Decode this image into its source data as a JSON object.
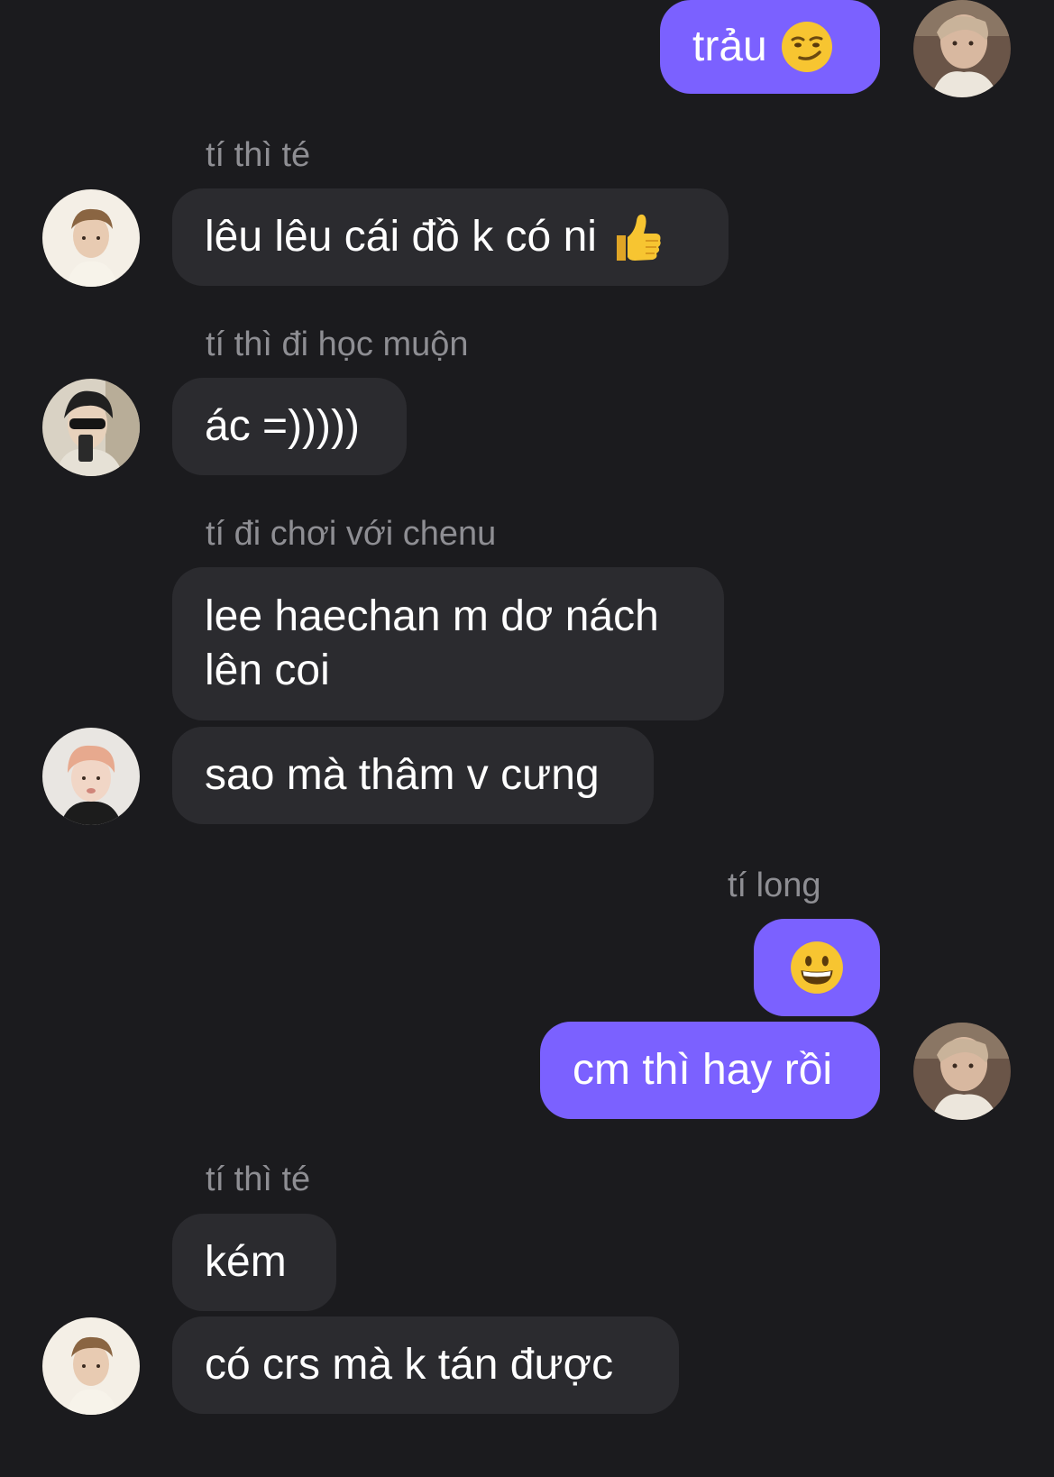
{
  "messages": [
    {
      "text": "trảu",
      "emoji": "smirking-face"
    },
    {
      "sender": "tí thì té",
      "text": "lêu lêu cái đồ k có ni",
      "emoji": "thumbs-up"
    },
    {
      "sender": "tí thì đi học muộn",
      "text": "ác =)))))"
    },
    {
      "sender": "tí đi chơi với chenu",
      "text": "lee haechan m dơ nách\nlên coi"
    },
    {
      "text": "sao mà thâm v cưng"
    },
    {
      "sender": "tí long",
      "emoji": "grinning-face"
    },
    {
      "text": "cm thì hay rồi"
    },
    {
      "sender": "tí thì té",
      "text": "kém"
    },
    {
      "text": "có crs mà k tán được"
    }
  ],
  "colors": {
    "background": "#1b1b1e",
    "incoming_bubble": "#2b2b2f",
    "outgoing_bubble": "#7b61ff",
    "sender_name": "#8e8e93",
    "message_text": "#ffffff"
  }
}
